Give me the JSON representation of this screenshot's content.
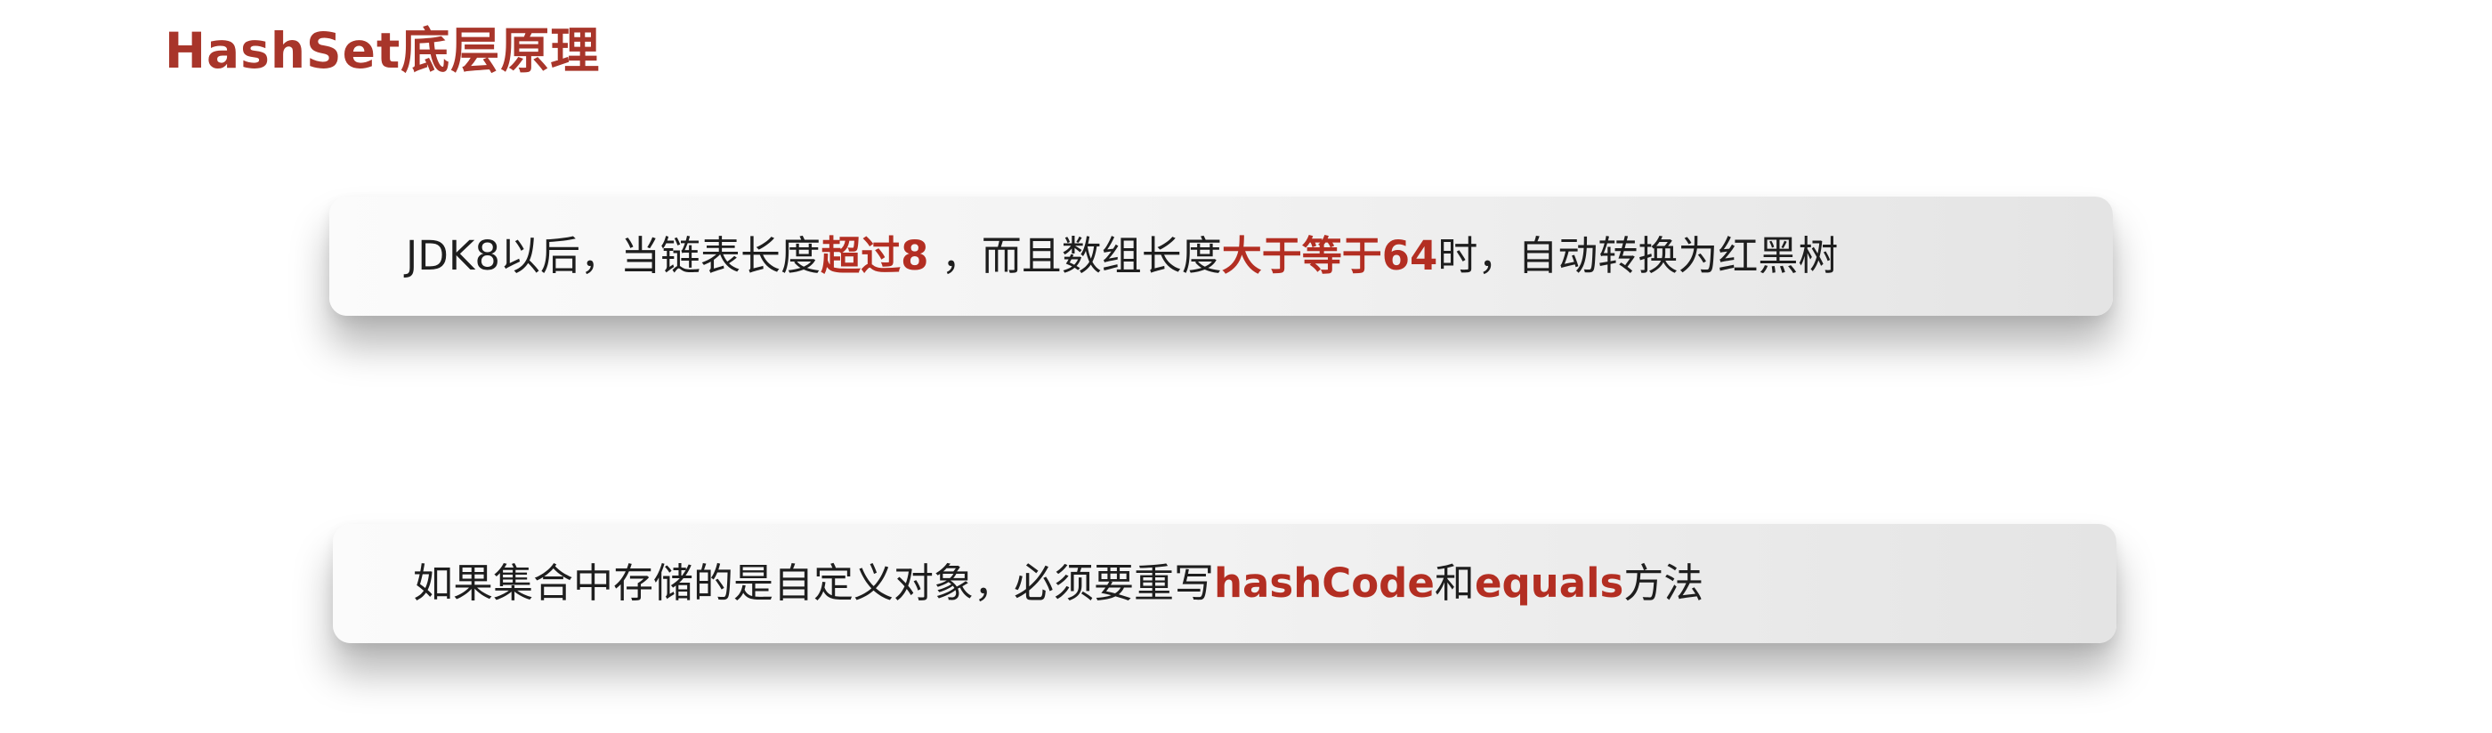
{
  "slide": {
    "title": "HashSet底层原理",
    "accent_color": "#b32e22",
    "title_color": "#a8352a"
  },
  "cards": [
    {
      "parts": [
        {
          "text": "JDK8以后，当链表长度"
        },
        {
          "text": "超过8",
          "highlight": true
        },
        {
          "text": " ，而且数组长度"
        },
        {
          "text": "大于等于64",
          "highlight": true
        },
        {
          "text": "时，自动转换为红黑树"
        }
      ]
    },
    {
      "parts": [
        {
          "text": "如果集合中存储的是自定义对象，必须要重写"
        },
        {
          "text": "hashCode",
          "highlight": true
        },
        {
          "text": "和"
        },
        {
          "text": "equals",
          "highlight": true
        },
        {
          "text": "方法"
        }
      ]
    }
  ]
}
